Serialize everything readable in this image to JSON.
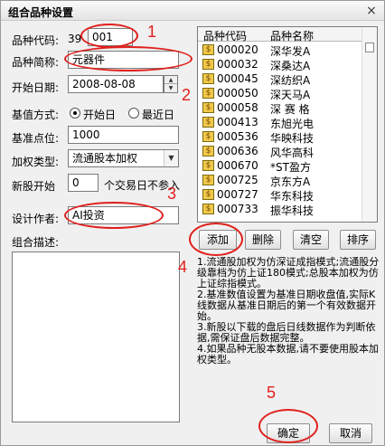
{
  "window": {
    "title": "组合品种设置",
    "close_label": "×"
  },
  "form": {
    "code_label": "品种代码:",
    "code_prefix": "39",
    "code_value": "001",
    "name_label": "品种简称:",
    "name_value": "元器件",
    "start_date_label": "开始日期:",
    "start_date_value": "2008-08-08",
    "base_method_label": "基值方式:",
    "base_method_options": [
      "开始日",
      "最近日"
    ],
    "base_method_selected": "开始日",
    "base_point_label": "基准点位:",
    "base_point_value": "1000",
    "weight_type_label": "加权类型:",
    "weight_type_value": "流通股本加权",
    "new_stock_label": "新股开始",
    "new_stock_value": "0",
    "new_stock_suffix": "个交易日不参入",
    "author_label": "设计作者:",
    "author_value": "AI投资",
    "description_label": "组合描述:"
  },
  "list": {
    "columns": [
      "品种代码",
      "品种名称"
    ],
    "rows": [
      {
        "code": "000020",
        "name": "深华发A"
      },
      {
        "code": "000032",
        "name": "深桑达A"
      },
      {
        "code": "000045",
        "name": "深纺织A"
      },
      {
        "code": "000050",
        "name": "深天马A"
      },
      {
        "code": "000058",
        "name": "深 赛 格"
      },
      {
        "code": "000413",
        "name": "东旭光电"
      },
      {
        "code": "000536",
        "name": "华映科技"
      },
      {
        "code": "000636",
        "name": "风华高科"
      },
      {
        "code": "000670",
        "name": "*ST盈方"
      },
      {
        "code": "000725",
        "name": "京东方A"
      },
      {
        "code": "000727",
        "name": "华东科技"
      },
      {
        "code": "000733",
        "name": "振华科技"
      }
    ]
  },
  "buttons": {
    "add": "添加",
    "delete": "删除",
    "clear": "清空",
    "sort": "排序",
    "ok": "确定",
    "cancel": "取消"
  },
  "notes": [
    "1.流通股加权为仿深证成指模式;流通股分级靠档为仿上证180模式;总股本加权为仿上证综指模式。",
    "2.基准数值设置为基准日期收盘值,实际K线数据从基准日期后的第一个有效数据开始。",
    "3.新股以下载的盘后日线数据作为判断依据,需保证盘后数据完整。",
    "4.如果品种无股本数据,请不要使用股本加权类型。"
  ],
  "annotations": [
    "1",
    "2",
    "3",
    "4",
    "5"
  ],
  "colors": {
    "annotation": "#e0201c",
    "checkbox_icon": "#f0c84a"
  }
}
